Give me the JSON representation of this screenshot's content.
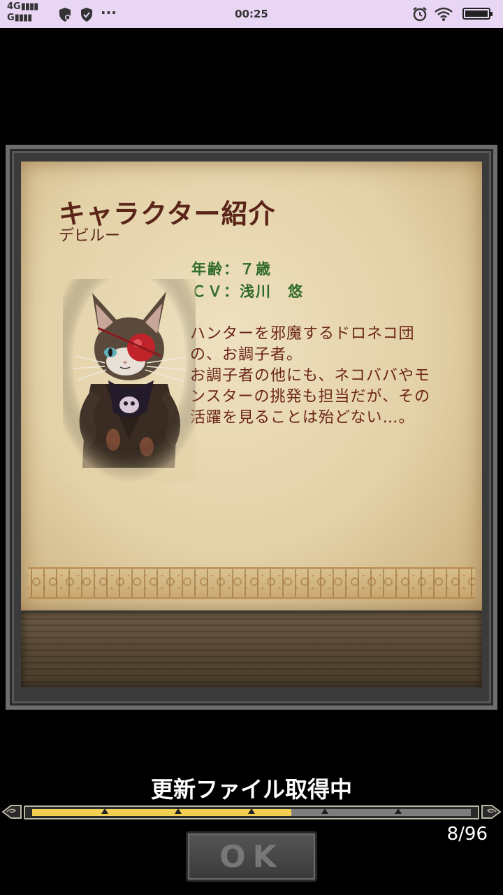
{
  "status_bar": {
    "network_top": "4G",
    "network_bottom": "G",
    "time": "00:25",
    "more": "···"
  },
  "card": {
    "title": "キャラクター紹介",
    "name": "デビルー",
    "age": "年齢：７歳",
    "cv": "ＣＶ：浅川　悠",
    "description_lines": [
      "ハンターを邪魔するドロネコ団",
      "の、お調子者。",
      "お調子者の他にも、ネコババやモ",
      "ンスターの挑発も担当だが、その",
      "活躍を見ることは殆どない…。"
    ]
  },
  "loading": {
    "label": "更新ファイル取得中",
    "counter": "8/96",
    "progress_fraction": 0.59,
    "bar_color": "#f0cf53"
  },
  "ok_button": {
    "label": "OK"
  }
}
